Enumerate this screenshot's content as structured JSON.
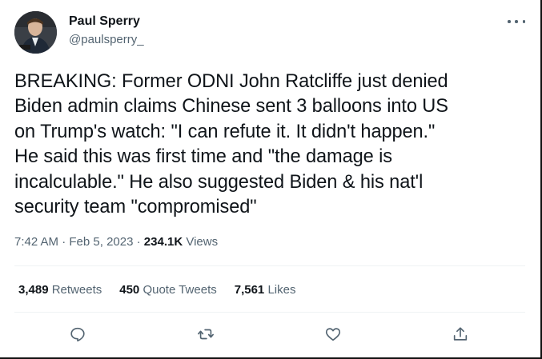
{
  "author": {
    "name": "Paul Sperry",
    "handle": "@paulsperry_"
  },
  "tweet": {
    "text": "BREAKING: Former ODNI John Ratcliffe just denied\nBiden admin claims Chinese sent 3 balloons into US\non Trump's watch: \"I can refute it. It didn't happen.\"\nHe said this was first time and \"the damage is\nincalculable.\" He also suggested Biden & his nat'l\nsecurity team \"compromised\""
  },
  "meta": {
    "time": "7:42 AM",
    "sep1": "·",
    "date": "Feb 5, 2023",
    "sep2": "·",
    "views_count": "234.1K",
    "views_label": "Views"
  },
  "stats": {
    "retweets_count": "3,489",
    "retweets_label": "Retweets",
    "quotes_count": "450",
    "quotes_label": "Quote Tweets",
    "likes_count": "7,561",
    "likes_label": "Likes"
  },
  "icons": {
    "more": "more-icon",
    "reply": "reply-icon",
    "retweet": "retweet-icon",
    "like": "like-icon",
    "share": "share-icon"
  },
  "colors": {
    "text": "#0f1419",
    "secondary": "#536471",
    "divider": "#eff3f4"
  }
}
